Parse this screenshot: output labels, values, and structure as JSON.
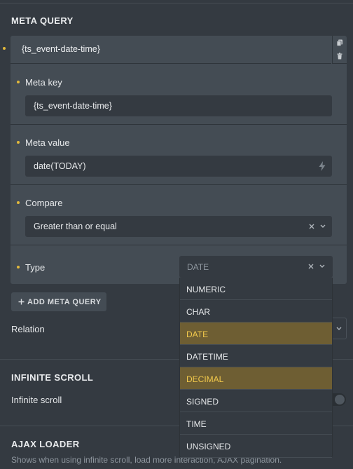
{
  "meta_query": {
    "title": "META QUERY",
    "item_title": "{ts_event-date-time}",
    "meta_key": {
      "label": "Meta key",
      "value": "{ts_event-date-time}"
    },
    "meta_value": {
      "label": "Meta value",
      "value": "date(TODAY)"
    },
    "compare": {
      "label": "Compare",
      "value": "Greater than or equal"
    },
    "type": {
      "label": "Type",
      "placeholder": "DATE",
      "options": [
        "NUMERIC",
        "CHAR",
        "DATE",
        "DATETIME",
        "DECIMAL",
        "SIGNED",
        "TIME",
        "UNSIGNED"
      ],
      "selected": "DATE",
      "highlighted": "DECIMAL"
    },
    "add_button": "ADD META QUERY",
    "relation_label": "Relation"
  },
  "infinite_scroll": {
    "title": "INFINITE SCROLL",
    "label": "Infinite scroll"
  },
  "ajax_loader": {
    "title": "AJAX LOADER",
    "description": "Shows when using infinite scroll, load more interaction, AJAX pagination."
  },
  "colors": {
    "background": "#343a41",
    "panel": "#444c54",
    "accent": "#e2b93b",
    "selected_bg": "#6e5e33",
    "selected_text": "#f2c94c"
  },
  "icons": [
    "copy-icon",
    "trash-icon",
    "bolt-icon",
    "clear-icon",
    "chevron-down-icon",
    "plus-icon"
  ]
}
